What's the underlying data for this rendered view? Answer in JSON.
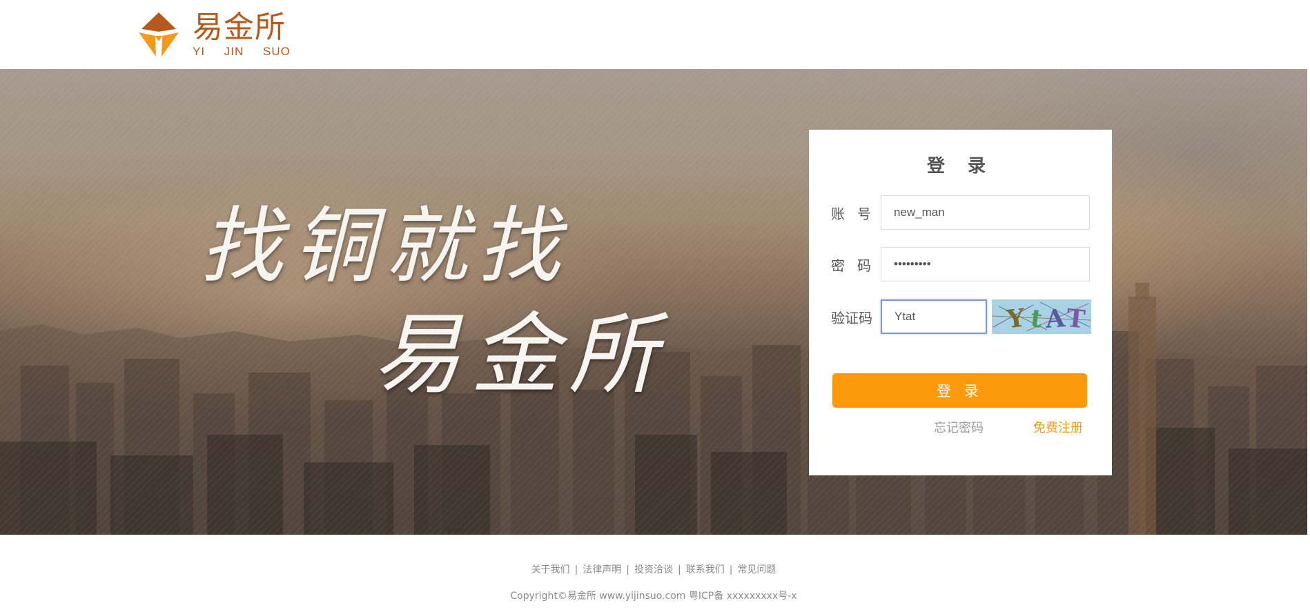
{
  "header": {
    "logo_cn": "易金所",
    "logo_en": "YI JIN SUO",
    "brand_color": "#b55a1c",
    "logo_icon": "diamond-roof-icon"
  },
  "hero": {
    "slogan_line1": "找铜就找",
    "slogan_line2": "易金所"
  },
  "login": {
    "title": "登 录",
    "account_label_a": "账",
    "account_label_b": "号",
    "account_value": "new_man",
    "password_label_a": "密",
    "password_label_b": "码",
    "password_value": "•••••••••",
    "captcha_label": "验证码",
    "captcha_value": "Ytat",
    "captcha_image_text": "YtAT",
    "submit_label": "登 录",
    "forgot_label": "忘记密码",
    "register_label": "免费注册",
    "accent_color": "#fb9a0b"
  },
  "footer": {
    "links": [
      "关于我们",
      "法律声明",
      "投资洽谈",
      "联系我们",
      "常见问题"
    ],
    "separator": "|",
    "copyright": "Copyright©易金所 www.yijinsuo.com 粤ICP备 xxxxxxxxx号-x"
  }
}
